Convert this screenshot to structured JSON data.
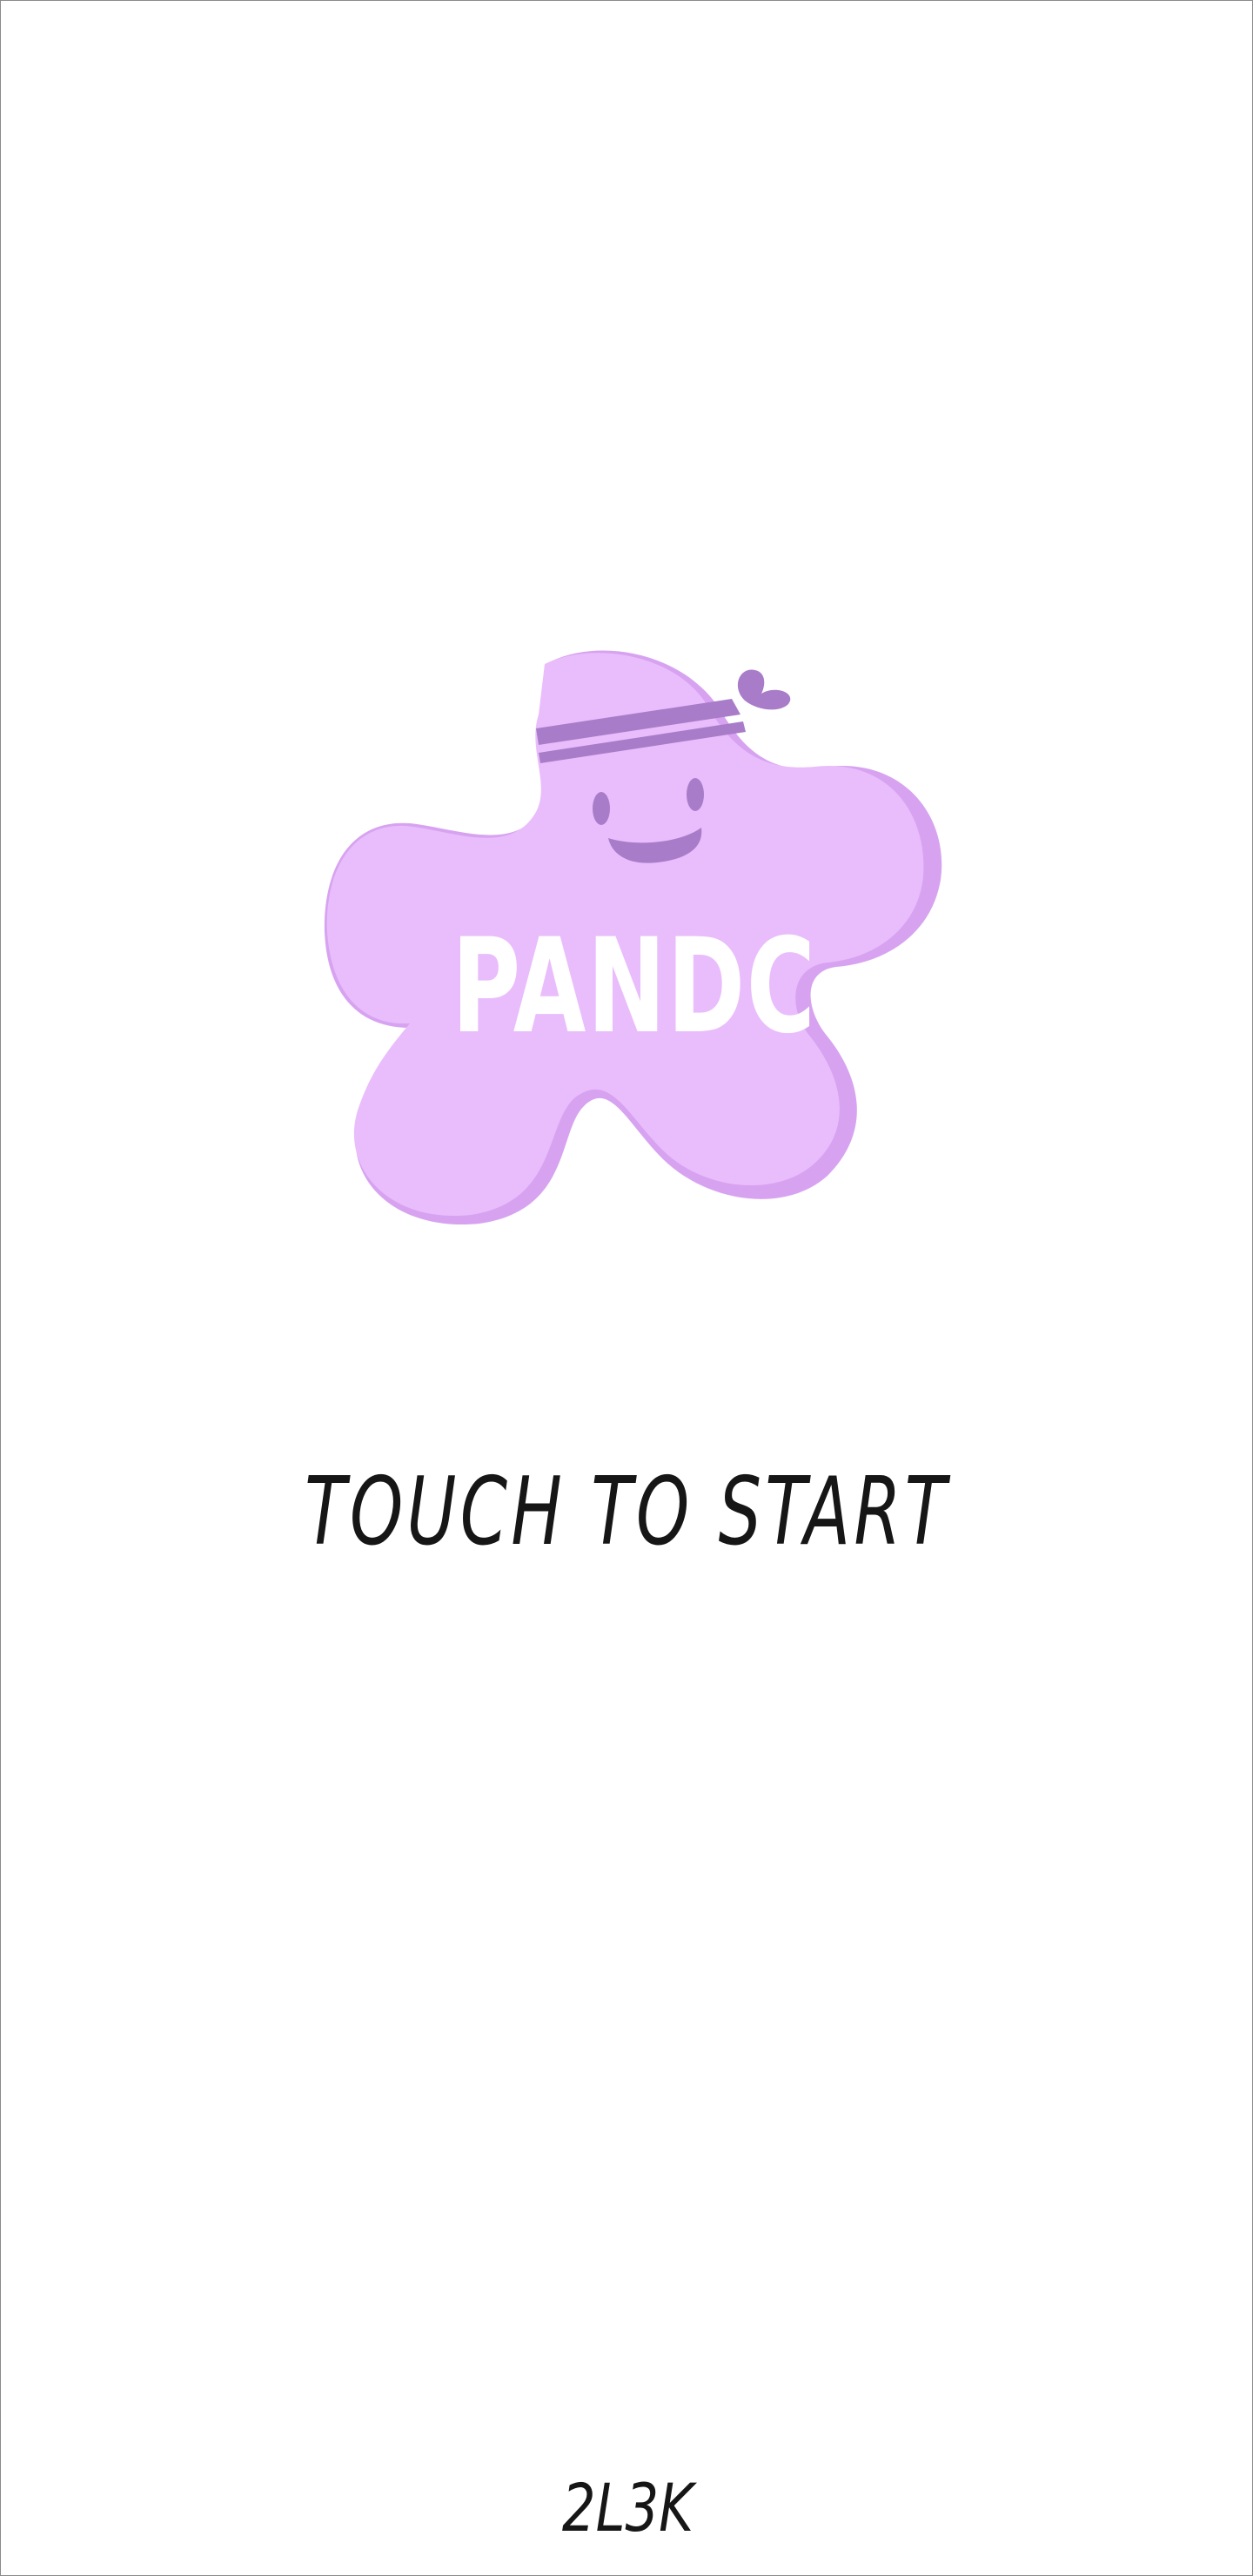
{
  "app": {
    "logo_text": "PANDC",
    "start_prompt": "TOUCH TO START",
    "studio_mark": "2L3K"
  },
  "colors": {
    "mascot_body": "#E9BDFB",
    "mascot_shadow": "#D7A3F1",
    "mascot_accent": "#A97CC9",
    "text_dark": "#161616"
  },
  "icons": {
    "mascot": "purple-blob-mascot-with-headband-icon"
  }
}
